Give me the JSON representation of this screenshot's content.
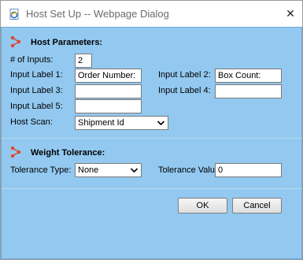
{
  "window": {
    "title": "Host Set Up -- Webpage Dialog",
    "close_glyph": "✕"
  },
  "host_parameters": {
    "heading": "Host Parameters:",
    "num_inputs_label": "# of Inputs:",
    "num_inputs_value": "2",
    "input_label_1": "Input Label 1:",
    "input_label_1_value": "Order Number:",
    "input_label_2": "Input Label 2:",
    "input_label_2_value": "Box Count:",
    "input_label_3": "Input Label 3:",
    "input_label_3_value": "",
    "input_label_4": "Input Label 4:",
    "input_label_4_value": "",
    "input_label_5": "Input Label 5:",
    "input_label_5_value": "",
    "host_scan_label": "Host Scan:",
    "host_scan_value": "Shipment Id"
  },
  "weight_tolerance": {
    "heading": "Weight Tolerance:",
    "tolerance_type_label": "Tolerance Type:",
    "tolerance_type_value": "None",
    "tolerance_value_label": "Tolerance Value:",
    "tolerance_value": "0"
  },
  "buttons": {
    "ok": "OK",
    "cancel": "Cancel"
  },
  "colors": {
    "client_background": "#93c9f0",
    "section_icon": "#e0462a"
  },
  "icons": {
    "app": "ie-document-icon",
    "section": "connector-nodes-icon",
    "dropdown": "chevron-down-icon",
    "close": "close-icon"
  }
}
